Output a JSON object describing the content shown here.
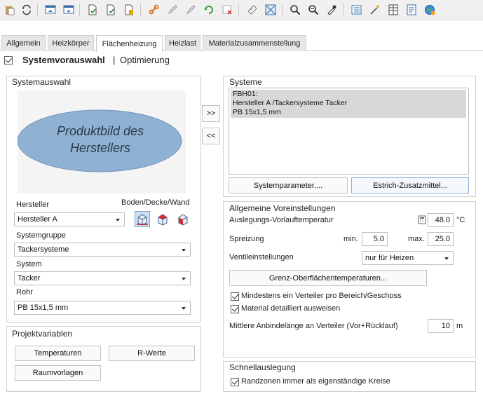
{
  "toolbar": {
    "icons": [
      "paste-icon",
      "refresh-icon",
      "import-icon",
      "export-icon",
      "new-doc-icon",
      "doc-check-icon",
      "doc-calc-icon",
      "link-icon",
      "pencil-icon",
      "pencil-alt-icon",
      "sync-icon",
      "delete-icon",
      "ruler-icon",
      "measure-icon",
      "zoom-icon",
      "zoom-fit-icon",
      "eyedropper-icon",
      "list-icon",
      "magic-wand-icon",
      "table-icon",
      "report-icon",
      "globe-icon"
    ]
  },
  "tabs": [
    "Allgemein",
    "Heizkörper",
    "Flächenheizung",
    "Heizlast",
    "Materialzusammenstellung"
  ],
  "active_tab": "Flächenheizung",
  "header": {
    "title": "Systemvorauswahl",
    "separator": "|",
    "subtitle": "Optimierung"
  },
  "systemauswahl": {
    "title": "Systemauswahl",
    "product_image_text": "Produktbild des Herstellers",
    "hersteller_label": "Hersteller",
    "hersteller_value": "Hersteller A",
    "boden_label": "Boden/Decke/Wand",
    "systemgruppe_label": "Systemgruppe",
    "systemgruppe_value": "Tackersysteme",
    "system_label": "System",
    "system_value": "Tacker",
    "rohr_label": "Rohr",
    "rohr_value": "PB 15x1,5 mm"
  },
  "transfer": {
    "add": ">>",
    "remove": "<<"
  },
  "systeme": {
    "title": "Systeme",
    "items": [
      "FBH01:",
      "Hersteller A  /Tackersysteme Tacker",
      "PB 15x1,5 mm"
    ],
    "btn_parameter": "Systemparameter....",
    "btn_estrich": "Estrich-Zusatzmittel..."
  },
  "voreinstellungen": {
    "title": "Allgemeine Voreinstellungen",
    "vorlauf_label": "Auslegungs-Vorlauftemperatur",
    "vorlauf_value": "48.0",
    "vorlauf_unit": "°C",
    "spreizung_label": "Spreizung",
    "min_label": "min.",
    "min_value": "5.0",
    "max_label": "max.",
    "max_value": "25.0",
    "ventil_label": "Ventileinstellungen",
    "ventil_value": "nur für Heizen",
    "grenz_button": "Grenz-Oberflächentemperaturen...",
    "check1": "Mindestens ein Verteiler pro Bereich/Geschoss",
    "check2": "Material detailliert ausweisen",
    "anbinde_label": "Mittlere Anbindelänge an Verteiler (Vor+Rücklauf)",
    "anbinde_value": "10",
    "anbinde_unit": "m"
  },
  "projektvariablen": {
    "title": "Projektvariablen",
    "btn_temperaturen": "Temperaturen",
    "btn_rwerte": "R-Werte",
    "btn_raumvorlagen": "Raumvorlagen"
  },
  "schnellauslegung": {
    "title": "Schnellauslegung",
    "check": "Randzonen immer als eigenständige Kreise"
  },
  "colors": {
    "ellipse_fill": "#8fb2d3",
    "ellipse_stroke": "#6f93b8",
    "image_bg": "#f4f4f4",
    "selection": "#d8d8d8",
    "floor_icon_active": "#cfe0f3"
  }
}
